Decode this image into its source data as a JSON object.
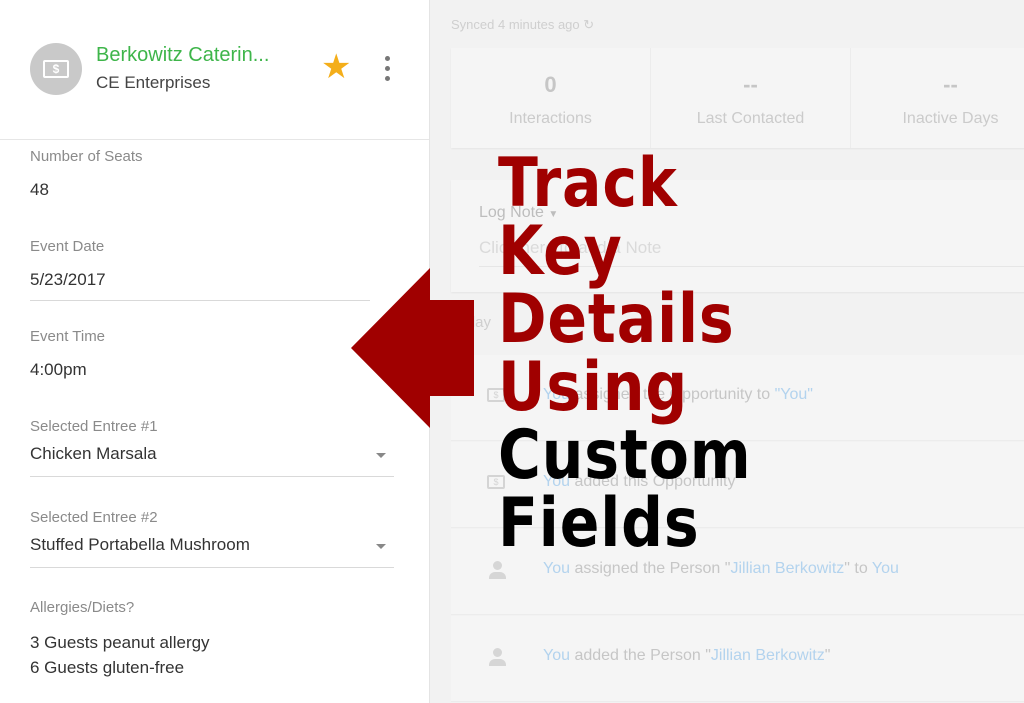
{
  "record": {
    "title": "Berkowitz Caterin...",
    "company": "CE Enterprises",
    "avatar_icon": "dollar-bill-icon",
    "starred": true
  },
  "fields": [
    {
      "label": "Number of Seats",
      "value": "48"
    },
    {
      "label": "Event Date",
      "value": "5/23/2017"
    },
    {
      "label": "Event Time",
      "value": "4:00pm"
    },
    {
      "label": "Selected Entree #1",
      "value": "Chicken Marsala"
    },
    {
      "label": "Selected Entree #2",
      "value": "Stuffed Portabella Mushroom"
    },
    {
      "label": "Allergies/Diets?",
      "value_lines": [
        "3 Guests peanut allergy",
        "6 Guests gluten-free"
      ]
    }
  ],
  "sync": {
    "text": "Synced 4 minutes ago"
  },
  "stats": [
    {
      "value": "0",
      "label": "Interactions"
    },
    {
      "value": "--",
      "label": "Last Contacted"
    },
    {
      "value": "--",
      "label": "Inactive Days"
    }
  ],
  "note": {
    "type": "Log Note",
    "placeholder": "Click here to add a Note"
  },
  "timeline": {
    "group": "Today",
    "items": [
      {
        "icon": "opportunity-icon",
        "actor": "You",
        "text": " assigned the Opportunity to ",
        "target": "\"You\"",
        "suffix": ""
      },
      {
        "icon": "opportunity-icon",
        "actor": "You",
        "text": " added this Opportunity",
        "target": "",
        "suffix": ""
      },
      {
        "icon": "person-icon",
        "actor": "You",
        "text": " assigned the Person \"",
        "target": "Jillian Berkowitz",
        "suffix": "\" to ",
        "suffix_link": "You"
      },
      {
        "icon": "person-icon",
        "actor": "You",
        "text": " added the Person \"",
        "target": "Jillian Berkowitz",
        "suffix": "\"",
        "suffix_link": ""
      }
    ]
  },
  "overlay": {
    "lines": [
      "Track",
      "Key",
      "Details",
      "Using",
      "Custom",
      "Fields"
    ],
    "accent_color": "#a00000",
    "secondary_color": "#000000"
  }
}
